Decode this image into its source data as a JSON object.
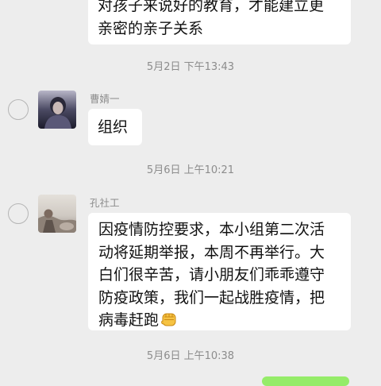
{
  "messages": [
    {
      "lines": [
        "对孩子来说好的教育，才能建立更",
        "亲密的亲子关系"
      ]
    },
    {
      "sender": "曹婧一",
      "avatar": "avatar-person-dark-icon",
      "lines": [
        "组织"
      ]
    },
    {
      "sender": "孔社工",
      "avatar": "avatar-landscape-icon",
      "lines": [
        "因疫情防控要求，本小组第二次活",
        "动将延期举报，本周不再举行。大",
        "白们很辛苦，请小朋友们乖乖遵守",
        "防疫政策，我们一起战胜疫情，把",
        "病毒赶跑"
      ],
      "trailing_emoji": "fist-emoji-icon"
    }
  ],
  "timestamps": [
    "5月2日 下午13:43",
    "5月6日 上午10:21",
    "5月6日 上午10:38"
  ],
  "colors": {
    "background": "#ededed",
    "bubble": "#ffffff",
    "self_bubble": "#95ec69",
    "meta_text": "#8c8c8c"
  }
}
